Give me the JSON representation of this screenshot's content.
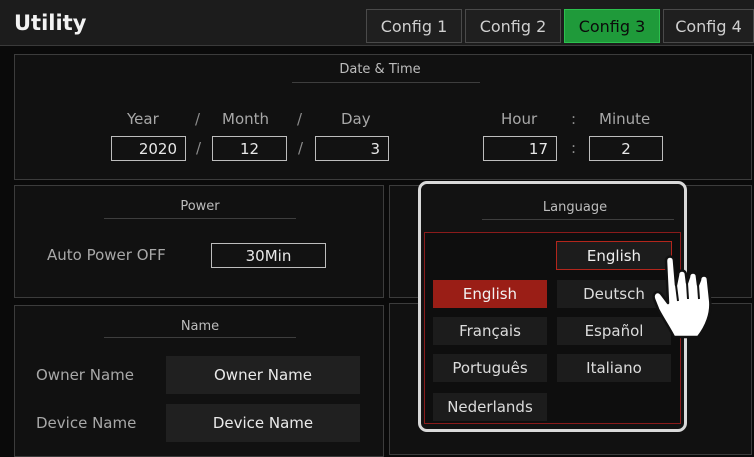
{
  "app": {
    "title": "Utility"
  },
  "tabs": [
    {
      "label": "Config 1",
      "active": false
    },
    {
      "label": "Config 2",
      "active": false
    },
    {
      "label": "Config 3",
      "active": true
    },
    {
      "label": "Config 4",
      "active": false
    }
  ],
  "datetime": {
    "title": "Date & Time",
    "year_label": "Year",
    "month_label": "Month",
    "day_label": "Day",
    "hour_label": "Hour",
    "minute_label": "Minute",
    "slash": "/",
    "colon": ":",
    "year": "2020",
    "month": "12",
    "day": "3",
    "hour": "17",
    "minute": "2"
  },
  "power": {
    "title": "Power",
    "auto_power_label": "Auto Power OFF",
    "auto_power_value": "30Min"
  },
  "name": {
    "title": "Name",
    "owner_label": "Owner Name",
    "owner_value": "Owner Name",
    "device_label": "Device Name",
    "device_value": "Device Name"
  },
  "language": {
    "title": "Language",
    "current": "English",
    "options": [
      "English",
      "Deutsch",
      "Français",
      "Español",
      "Português",
      "Italiano",
      "Nederlands"
    ],
    "selected": "English"
  },
  "colors": {
    "active_tab": "#1f9a3a",
    "selected_option": "#9a1e16",
    "highlight_frame": "#d9d9d9"
  },
  "icons": {
    "pointer": "pointing-hand-icon"
  }
}
